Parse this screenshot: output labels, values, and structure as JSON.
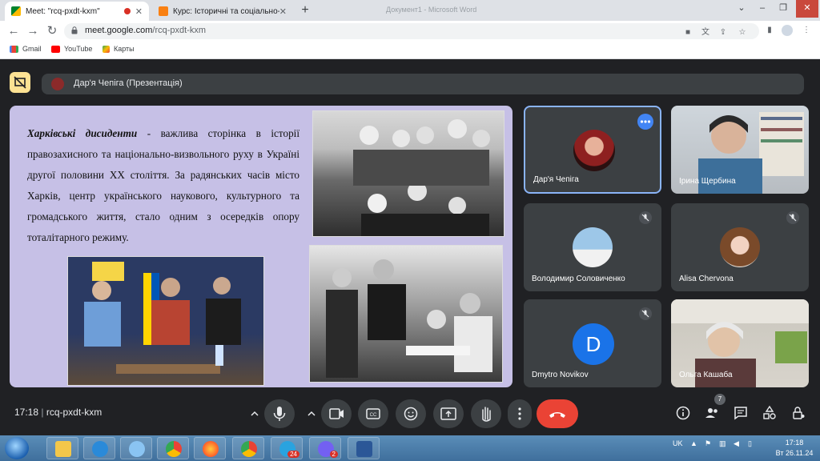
{
  "browser": {
    "tabs": [
      {
        "title": "Meet: \"rcq-pxdt-kxm\"",
        "active": true
      },
      {
        "title": "Курс: Історичні та соціально-по",
        "active": false
      }
    ],
    "ghost_window_title": "Документ1 - Microsoft Word",
    "url_host": "meet.google.com",
    "url_path": "/rcq-pxdt-kxm",
    "bookmarks": [
      "Gmail",
      "YouTube",
      "Карты"
    ]
  },
  "meet": {
    "presenter_label": "Дар'я Чепіга (Презентація)",
    "slide": {
      "heading": "Харківські дисиденти",
      "body": " - важлива сторінка в історії правозахисного та національно-визвольного руху в Україні другої половини ХХ століття. За радянських часів місто Харків, центр українського наукового, культурного та громадського життя, стало одним з осередків опору тоталітарного режиму."
    },
    "participants": [
      {
        "name": "Дар'я Чепіга",
        "muted": false
      },
      {
        "name": "Ірина Щербина",
        "muted": false
      },
      {
        "name": "Володимир Солoвиченко",
        "muted": true
      },
      {
        "name": "Alisa Chervona",
        "muted": true
      },
      {
        "name": "Dmytro Novikov",
        "muted": true,
        "initial": "D"
      },
      {
        "name": "Ольга Кашаба",
        "muted": false
      }
    ],
    "time": "17:18",
    "meeting_code": "rcq-pxdt-kxm",
    "participants_count": "7"
  },
  "taskbar": {
    "lang": "UK",
    "time": "17:18",
    "date": "Вт 26.11.24",
    "telegram_badge": "24",
    "viber_badge": "2"
  },
  "colors": {
    "meet_bg": "#202124",
    "slide_bg": "#c6c0e6",
    "end_call": "#ea4335",
    "active_border": "#8ab4f8"
  }
}
